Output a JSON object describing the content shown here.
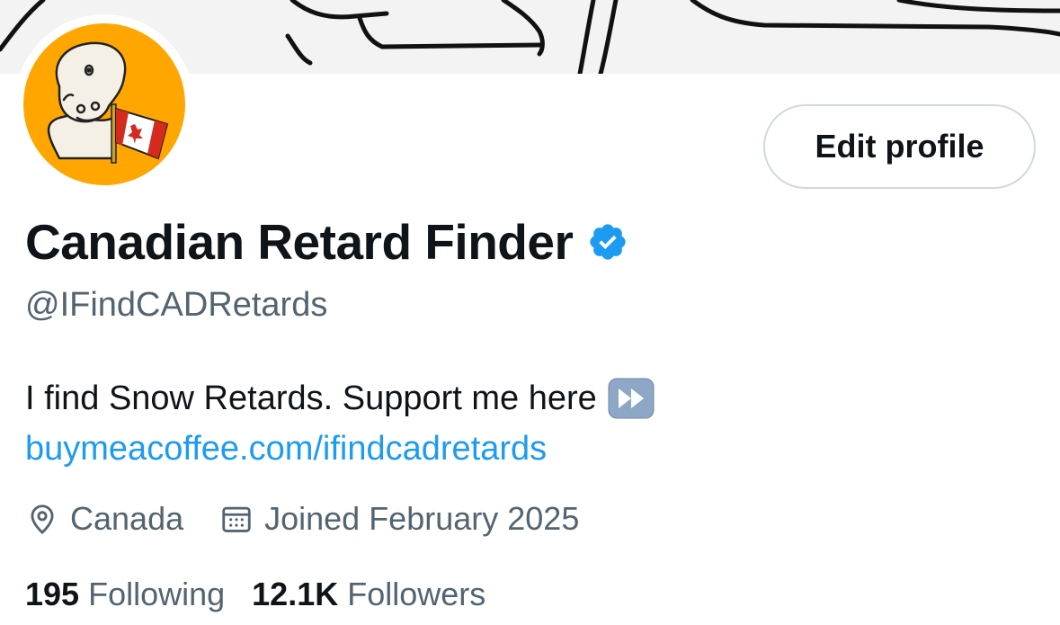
{
  "profile": {
    "display_name": "Canadian Retard Finder",
    "handle": "@IFindCADRetards",
    "verified": true,
    "bio_text": "I find Snow Retards. Support me here",
    "bio_emoji": "fast-forward-emoji",
    "link": "buymeacoffee.com/ifindcadretards",
    "location": "Canada",
    "joined": "Joined February 2025",
    "following_count": "195",
    "following_label": "Following",
    "followers_count": "12.1K",
    "followers_label": "Followers"
  },
  "buttons": {
    "edit_profile": "Edit profile"
  },
  "icons": {
    "location": "location-pin-icon",
    "calendar": "calendar-icon",
    "verified": "verified-badge-icon"
  },
  "colors": {
    "accent": "#1d9bf0",
    "secondary_text": "#536471",
    "avatar_bg": "#ffa600",
    "verified": "#1d9bf0"
  }
}
